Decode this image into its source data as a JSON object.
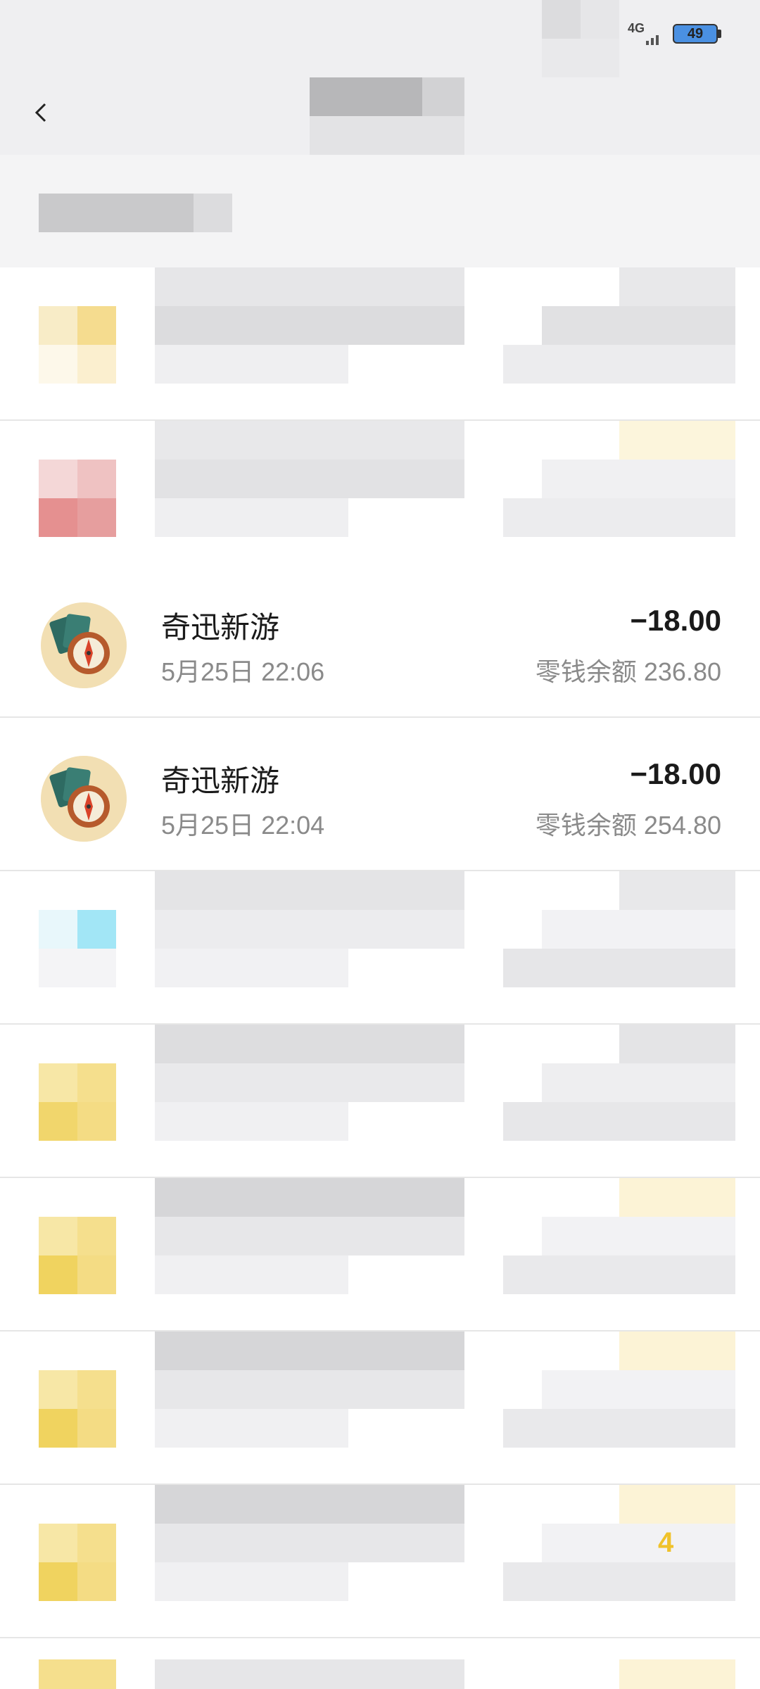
{
  "status_bar": {
    "network": "4G",
    "battery": "49",
    "battery_color": "#4a90e2"
  },
  "header": {
    "back_icon": "chevron-left-icon"
  },
  "transactions": [
    {
      "title": "奇迅新游",
      "time": "5月25日 22:06",
      "amount": "−18.00",
      "balance": "零钱余额 236.80",
      "icon": "compass-cards-icon"
    },
    {
      "title": "奇迅新游",
      "time": "5月25日 22:04",
      "amount": "−18.00",
      "balance": "零钱余额 254.80",
      "icon": "compass-cards-icon"
    }
  ],
  "partial_visible": {
    "digit": "4",
    "accent_color": "#f0c22a"
  }
}
